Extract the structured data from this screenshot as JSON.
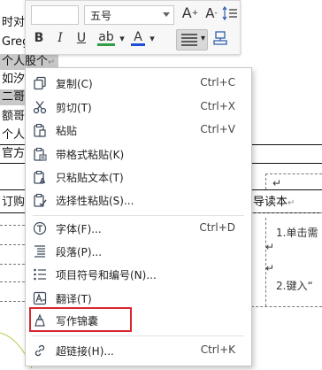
{
  "document": {
    "lines": [
      "时对",
      "Greg",
      "个人股个",
      "如汐",
      "二哥",
      "额哥",
      "个人"
    ],
    "enter_mark": "↵",
    "line_guanfang": "官方",
    "line_dinggou": "订购",
    "right_segment": "导读本",
    "right_text_1": "1.单击需",
    "right_text_2": "2.键入“"
  },
  "mini_toolbar": {
    "font_size": "五号",
    "bold": "B",
    "italic": "I",
    "underline": "U",
    "highlight": "ab",
    "font_color": "A",
    "grow_font": "A",
    "shrink_font": "A"
  },
  "context_menu": {
    "items": [
      {
        "label": "复制(C)",
        "shortcut": "Ctrl+C",
        "icon": "copy-icon"
      },
      {
        "label": "剪切(T)",
        "shortcut": "Ctrl+X",
        "icon": "cut-icon"
      },
      {
        "label": "粘贴",
        "shortcut": "Ctrl+V",
        "icon": "paste-icon"
      },
      {
        "label": "带格式粘贴(K)",
        "shortcut": "",
        "icon": "paste-format-icon"
      },
      {
        "label": "只粘贴文本(T)",
        "shortcut": "",
        "icon": "paste-text-icon"
      },
      {
        "label": "选择性粘贴(S)...",
        "shortcut": "",
        "icon": "paste-special-icon"
      },
      {
        "label": "字体(F)...",
        "shortcut": "Ctrl+D",
        "icon": "font-icon"
      },
      {
        "label": "段落(P)...",
        "shortcut": "",
        "icon": "paragraph-icon"
      },
      {
        "label": "项目符号和编号(N)...",
        "shortcut": "",
        "icon": "bullets-icon"
      },
      {
        "label": "翻译(T)",
        "shortcut": "",
        "icon": "translate-icon"
      },
      {
        "label": "写作锦囊",
        "shortcut": "",
        "icon": "writing-tips-icon"
      },
      {
        "label": "超链接(H)...",
        "shortcut": "Ctrl+K",
        "icon": "hyperlink-icon"
      }
    ]
  },
  "colors": {
    "highlight_red": "#d9272e",
    "menu_icon": "#3d4a5c",
    "font_color_bar": "#1f4fd8",
    "highlight_bar": "#2f9e44"
  }
}
